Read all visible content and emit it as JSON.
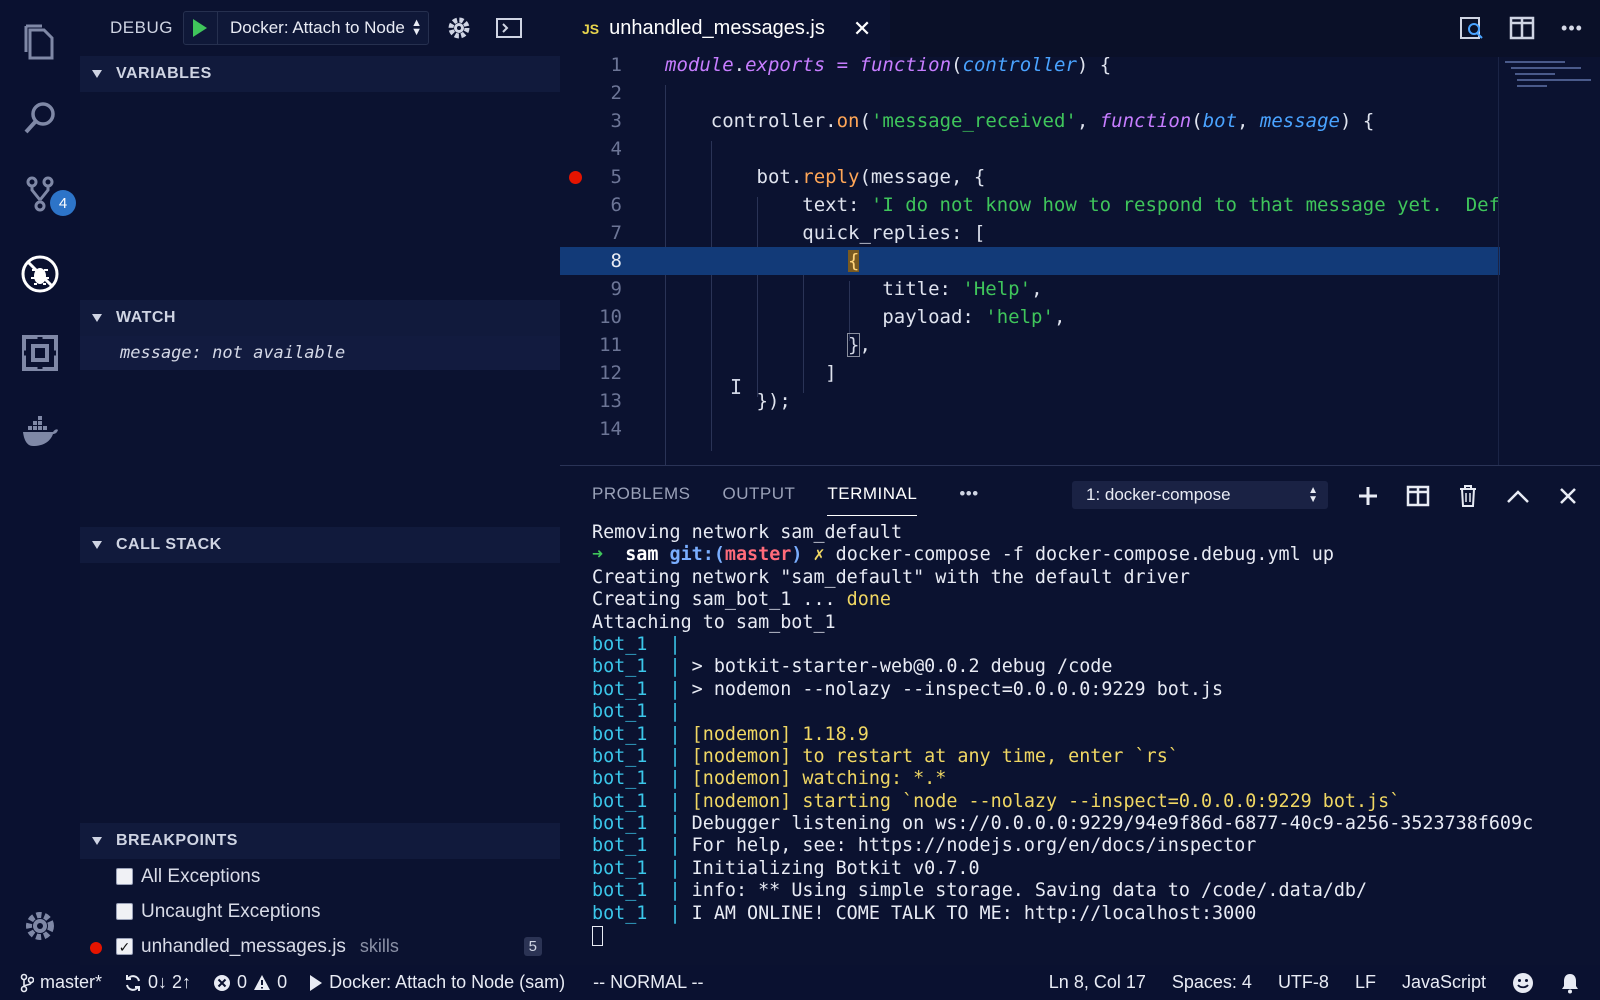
{
  "activity": {
    "scm_badge": "4"
  },
  "debug": {
    "label": "DEBUG",
    "config": "Docker: Attach to Node"
  },
  "sections": {
    "variables": "VARIABLES",
    "watch": "WATCH",
    "call_stack": "CALL STACK",
    "breakpoints": "BREAKPOINTS"
  },
  "watch": {
    "expr": "message:",
    "value": "not available"
  },
  "breakpoints": [
    {
      "label": "All Exceptions",
      "checked": false
    },
    {
      "label": "Uncaught Exceptions",
      "checked": false
    },
    {
      "label": "unhandled_messages.js",
      "checked": true,
      "desc": "skills",
      "count": "5"
    }
  ],
  "editor": {
    "tab_label": "unhandled_messages.js",
    "tab_lang_badge": "JS",
    "current_line": 8,
    "breakpoint_line": 5,
    "line_numbers": [
      "1",
      "2",
      "3",
      "4",
      "5",
      "6",
      "7",
      "8",
      "9",
      "10",
      "11",
      "12",
      "13",
      "14"
    ]
  },
  "panel": {
    "tabs": [
      "PROBLEMS",
      "OUTPUT",
      "TERMINAL"
    ],
    "active_tab": "TERMINAL",
    "more": "•••",
    "terminal_select": "1: docker-compose"
  },
  "terminal": {
    "removing": "Removing network sam_default",
    "prompt_user": "sam",
    "prompt_git": "git:(",
    "prompt_branch": "master",
    "prompt_close": ")",
    "prompt_mark": "✗",
    "command": "docker-compose -f docker-compose.debug.yml up",
    "creating_network": "Creating network \"sam_default\" with the default driver",
    "creating_bot": "Creating sam_bot_1 ... ",
    "done": "done",
    "attaching": "Attaching to sam_bot_1",
    "bot_prefix": "bot_1",
    "bot_lines": [
      {
        "text": "",
        "color": "white"
      },
      {
        "text": "> botkit-starter-web@0.0.2 debug /code",
        "color": "white"
      },
      {
        "text": "> nodemon --nolazy --inspect=0.0.0.0:9229 bot.js",
        "color": "white"
      },
      {
        "text": "",
        "color": "white"
      },
      {
        "text": "[nodemon] 1.18.9",
        "color": "yellow"
      },
      {
        "text": "[nodemon] to restart at any time, enter `rs`",
        "color": "yellow"
      },
      {
        "text": "[nodemon] watching: *.*",
        "color": "yellow"
      },
      {
        "text": "[nodemon] starting `node --nolazy --inspect=0.0.0.0:9229 bot.js`",
        "color": "green"
      },
      {
        "text": "Debugger listening on ws://0.0.0.0:9229/94e9f86d-6877-40c9-a256-3523738f609c",
        "color": "white"
      },
      {
        "text": "For help, see: https://nodejs.org/en/docs/inspector",
        "color": "white"
      },
      {
        "text": "Initializing Botkit v0.7.0",
        "color": "white"
      },
      {
        "text": "info: ** Using simple storage. Saving data to /code/.data/db/",
        "color": "white"
      },
      {
        "text": "I AM ONLINE! COME TALK TO ME: http://localhost:3000",
        "color": "white"
      }
    ]
  },
  "status": {
    "branch": "master*",
    "sync": "0↓ 2↑",
    "errors": "0",
    "warnings": "0",
    "debug_session": "Docker: Attach to Node (sam)",
    "vim_mode": "-- NORMAL --",
    "position": "Ln 8, Col 17",
    "spaces": "Spaces: 4",
    "encoding": "UTF-8",
    "eol": "LF",
    "language": "JavaScript"
  },
  "colors": {
    "background": "#0b1230",
    "selection": "#123a78",
    "breakpoint": "#e51400",
    "accent": "#2d74c8"
  }
}
